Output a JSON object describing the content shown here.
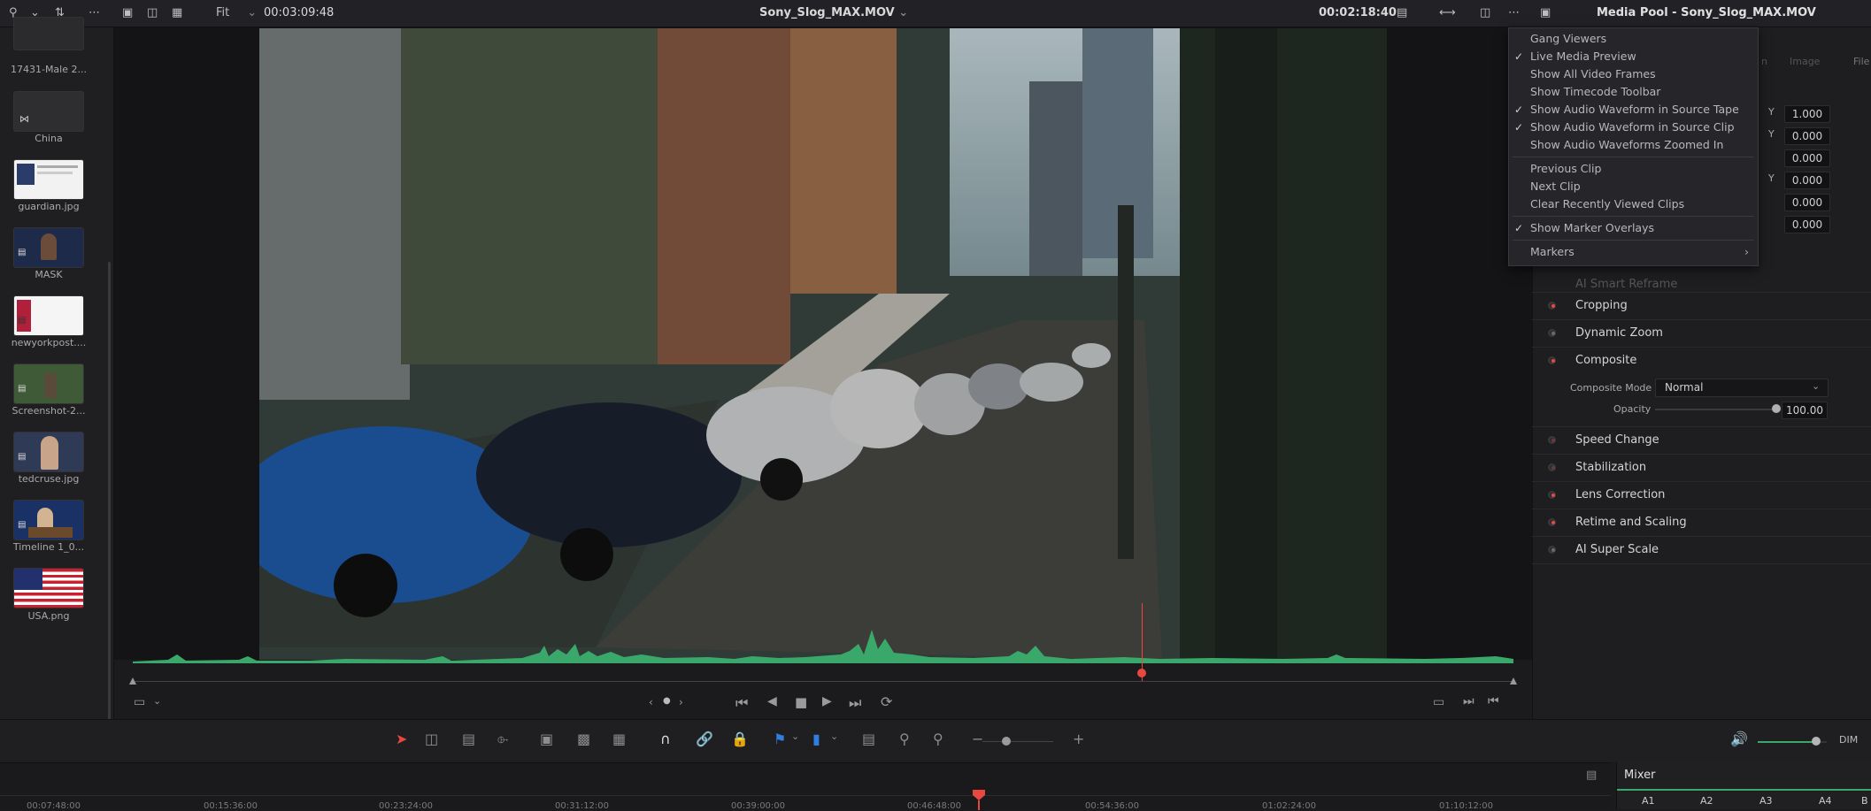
{
  "topbar": {
    "zoom_label": "Fit",
    "source_timecode": "00:03:09:48",
    "clip_name": "Sony_Slog_MAX.MOV",
    "duration_timecode": "00:02:18:40",
    "right_title": "Media Pool - Sony_Slog_MAX.MOV"
  },
  "media_bin": {
    "items": [
      {
        "label": "17431-Male 2...",
        "kind": "video"
      },
      {
        "label": "China",
        "kind": "compound"
      },
      {
        "label": "guardian.jpg",
        "kind": "image"
      },
      {
        "label": "MASK",
        "kind": "video"
      },
      {
        "label": "newyorkpost....",
        "kind": "image"
      },
      {
        "label": "Screenshot-2...",
        "kind": "image"
      },
      {
        "label": "tedcruse.jpg",
        "kind": "image"
      },
      {
        "label": "Timeline 1_0...",
        "kind": "timeline"
      },
      {
        "label": "USA.png",
        "kind": "image"
      }
    ]
  },
  "menu": {
    "items": [
      {
        "label": "Gang Viewers",
        "checked": false
      },
      {
        "label": "Live Media Preview",
        "checked": true
      },
      {
        "label": "Show All Video Frames",
        "checked": false
      },
      {
        "label": "Show Timecode Toolbar",
        "checked": false
      },
      {
        "label": "Show Audio Waveform in Source Tape",
        "checked": true
      },
      {
        "label": "Show Audio Waveform in Source Clip",
        "checked": true
      },
      {
        "label": "Show Audio Waveforms Zoomed In",
        "checked": false
      },
      {
        "label": "Previous Clip",
        "checked": false
      },
      {
        "label": "Next Clip",
        "checked": false
      },
      {
        "label": "Clear Recently Viewed Clips",
        "checked": false
      },
      {
        "label": "Show Marker Overlays",
        "checked": true
      },
      {
        "label": "Markers",
        "checked": false,
        "submenu": true
      }
    ],
    "check_mark": "✓",
    "submenu_arrow": "›"
  },
  "inspector": {
    "tabs": [
      "n",
      "Image",
      "File"
    ],
    "transform_values": [
      {
        "axis": "Y",
        "value": "1.000"
      },
      {
        "axis": "Y",
        "value": "0.000"
      },
      {
        "axis": "",
        "value": "0.000"
      },
      {
        "axis": "Y",
        "value": "0.000"
      },
      {
        "axis": "",
        "value": "0.000"
      },
      {
        "axis": "",
        "value": "0.000"
      }
    ],
    "smart_reframe": "AI Smart Reframe",
    "sections": [
      {
        "label": "Cropping",
        "enabled": true
      },
      {
        "label": "Dynamic Zoom",
        "enabled": false
      },
      {
        "label": "Composite",
        "enabled": true
      },
      {
        "label": "Speed Change",
        "enabled": false
      },
      {
        "label": "Stabilization",
        "enabled": false
      },
      {
        "label": "Lens Correction",
        "enabled": true
      },
      {
        "label": "Retime and Scaling",
        "enabled": true
      },
      {
        "label": "AI Super Scale",
        "enabled": false
      }
    ],
    "composite_mode_label": "Composite Mode",
    "composite_mode_value": "Normal",
    "opacity_label": "Opacity",
    "opacity_value": "100.00",
    "opacity_fraction": 1.0
  },
  "timeline": {
    "ruler": [
      "00:07:48:00",
      "00:15:36:00",
      "00:23:24:00",
      "00:31:12:00",
      "00:39:00:00",
      "00:46:48:00",
      "00:54:36:00",
      "01:02:24:00",
      "01:10:12:00"
    ]
  },
  "mixer": {
    "title": "Mixer",
    "channels": [
      "A1",
      "A2",
      "A3",
      "A4",
      "B"
    ]
  },
  "audio": {
    "dim_label": "DIM",
    "volume_fraction": 0.85
  },
  "playhead_fraction": 0.73,
  "colors": {
    "accent_red": "#e8483f",
    "waveform_green": "#3aa86a",
    "blue_flag": "#2f7fe0"
  }
}
